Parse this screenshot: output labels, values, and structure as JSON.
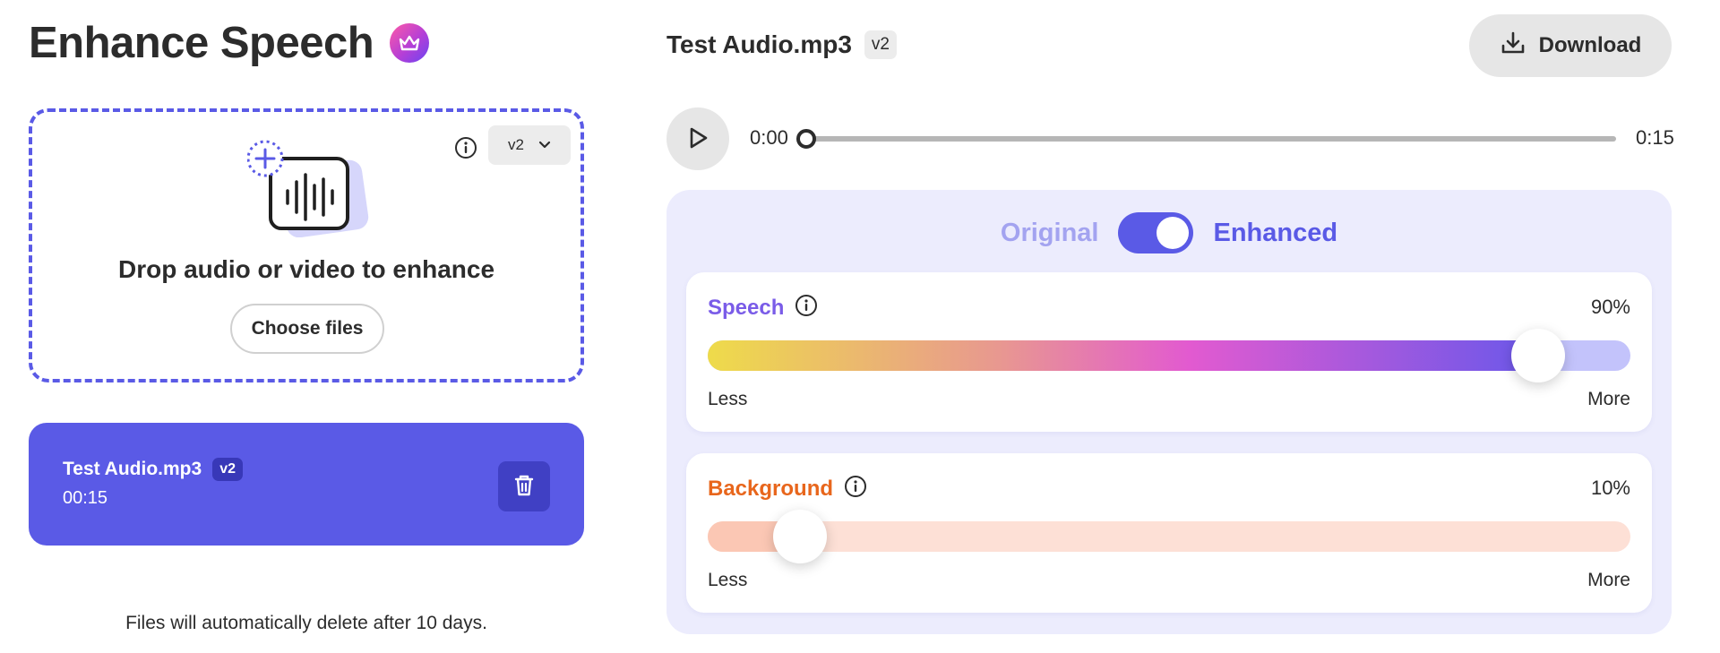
{
  "app": {
    "title": "Enhance Speech",
    "premium_icon": "crown-icon",
    "accent_color": "#5a5ae6"
  },
  "dropzone": {
    "prompt": "Drop audio or video to enhance",
    "choose_label": "Choose files",
    "version_selected": "v2",
    "info_icon": "info-icon",
    "dropdown_icon": "chevron-down-icon"
  },
  "file_list": [
    {
      "name": "Test Audio.mp3",
      "version": "v2",
      "duration": "00:15",
      "delete_icon": "trash-icon"
    }
  ],
  "footer_note": "Files will automatically delete after 10 days.",
  "player": {
    "file_name": "Test Audio.mp3",
    "version": "v2",
    "download_label": "Download",
    "current_time": "0:00",
    "total_time": "0:15",
    "progress": 0
  },
  "toggle": {
    "left_label": "Original",
    "right_label": "Enhanced",
    "state": "enhanced"
  },
  "sliders": {
    "speech": {
      "label": "Speech",
      "value_text": "90%",
      "value": 90,
      "min_label": "Less",
      "max_label": "More",
      "color": "#7a5ce8"
    },
    "background": {
      "label": "Background",
      "value_text": "10%",
      "value": 10,
      "min_label": "Less",
      "max_label": "More",
      "color": "#e8661c"
    }
  }
}
